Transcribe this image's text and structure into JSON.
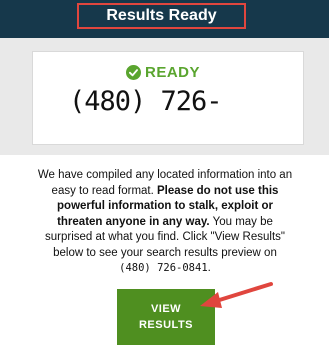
{
  "header": {
    "title": "Results Ready"
  },
  "status_card": {
    "status_label": "READY",
    "status_icon": "check-circle-icon",
    "phone_partial": "(480) 726-"
  },
  "description": {
    "part1": "We have compiled any located information into an easy to read format. ",
    "bold": "Please do not use this powerful information to stalk, exploit or threaten anyone in any way.",
    "part2": " You may be surprised at what you find. Click \"View Results\" below to see your search results preview on ",
    "phone": "(480) 726-0841",
    "end": "."
  },
  "cta": {
    "line1": "VIEW",
    "line2": "RESULTS"
  },
  "colors": {
    "header_bg": "#16384b",
    "highlight_border": "#e0463e",
    "ready_green": "#5aa52f",
    "button_green": "#4f8f20",
    "arrow_red": "#e0463e"
  }
}
